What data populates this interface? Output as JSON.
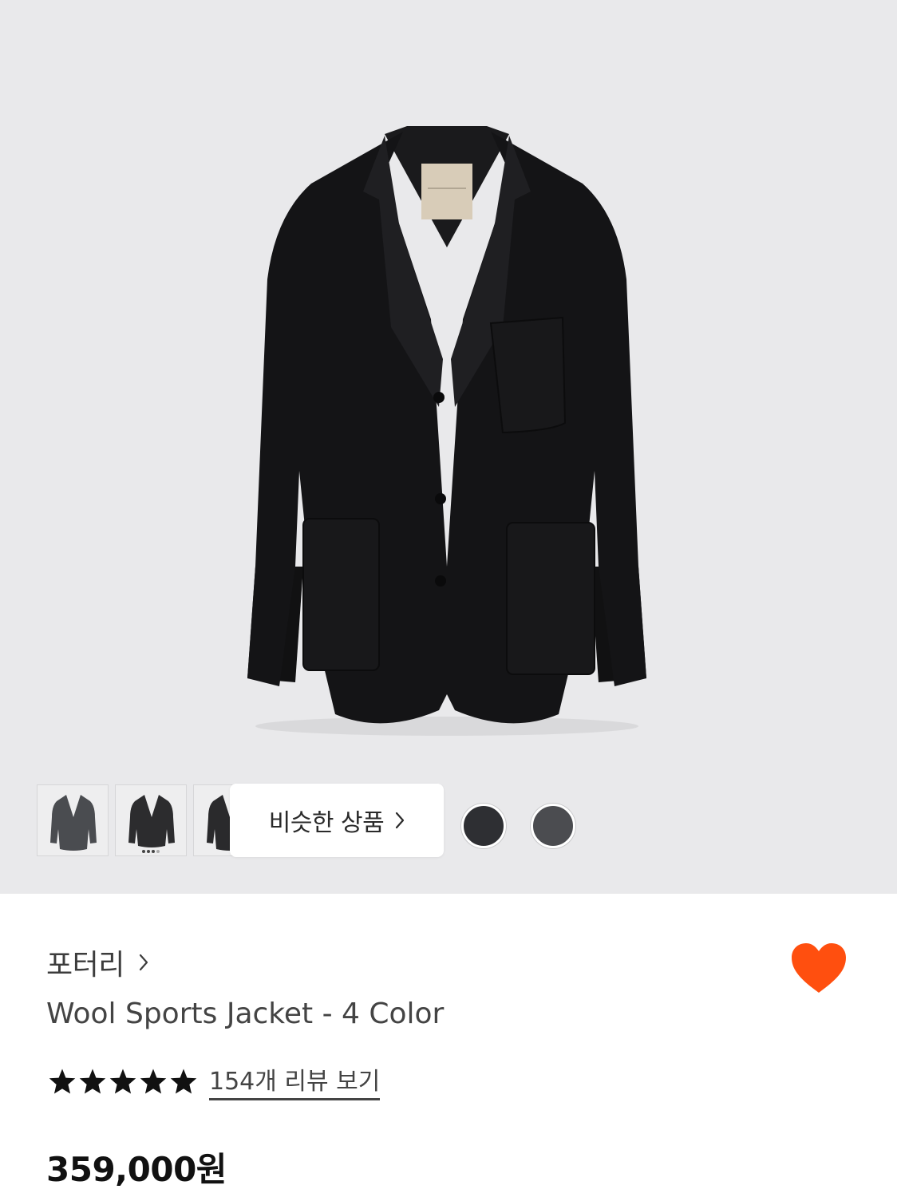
{
  "hero": {
    "image_alt": "Wool Sports Jacket product image",
    "background_color": "#e9e9eb"
  },
  "gallery": {
    "thumbnails": [
      {
        "name": "thumbnail-1",
        "jacket_color": "#4a4c50"
      },
      {
        "name": "thumbnail-2",
        "jacket_color": "#2c2c2e"
      },
      {
        "name": "thumbnail-3",
        "jacket_color": "#2a2a2c"
      }
    ],
    "similar_button_label": "비슷한 상품",
    "swatches": [
      {
        "name": "color-swatch-1",
        "color": "#2e2f33"
      },
      {
        "name": "color-swatch-2",
        "color": "#4b4c50"
      }
    ]
  },
  "product": {
    "brand": "포터리",
    "title": "Wool Sports Jacket - 4 Color",
    "rating_stars": 5,
    "review_link": "154개 리뷰 보기",
    "price": "359,000원",
    "favorited": true,
    "heart_color": "#ff4f0f"
  }
}
